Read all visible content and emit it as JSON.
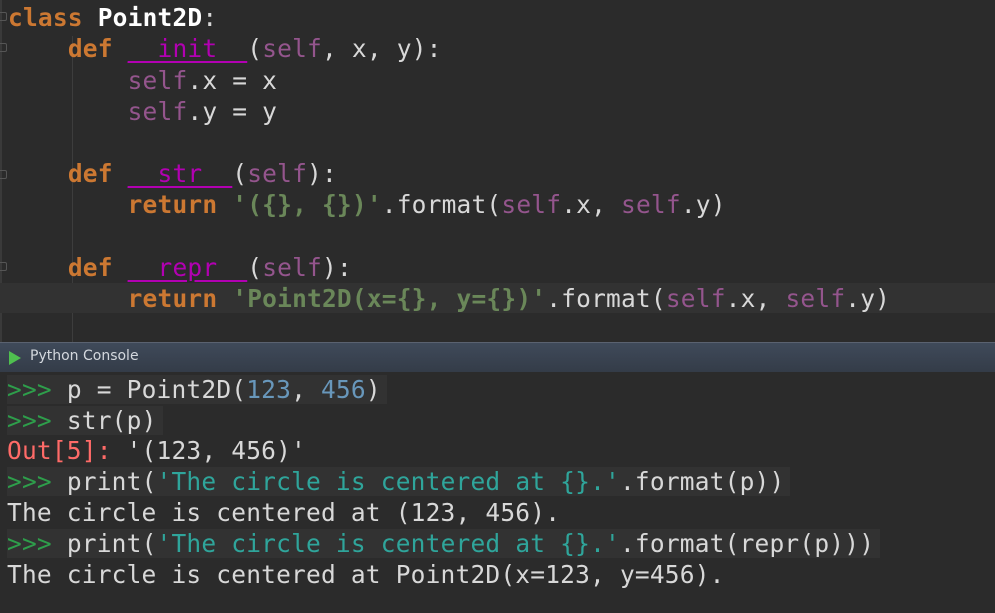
{
  "editor": {
    "lines": [
      {
        "segments": [
          [
            "kw",
            "class"
          ],
          [
            "plain",
            " "
          ],
          [
            "cls",
            "Point2D"
          ],
          [
            "plain",
            ":"
          ]
        ]
      },
      {
        "segments": [
          [
            "plain",
            "    "
          ],
          [
            "kw",
            "def"
          ],
          [
            "plain",
            " "
          ],
          [
            "dunder",
            "__init__"
          ],
          [
            "plain",
            "("
          ],
          [
            "self",
            "self"
          ],
          [
            "plain",
            ", x, y):"
          ]
        ]
      },
      {
        "segments": [
          [
            "plain",
            "        "
          ],
          [
            "self",
            "self"
          ],
          [
            "plain",
            ".x = x"
          ]
        ]
      },
      {
        "segments": [
          [
            "plain",
            "        "
          ],
          [
            "self",
            "self"
          ],
          [
            "plain",
            ".y = y"
          ]
        ]
      },
      {
        "segments": []
      },
      {
        "segments": [
          [
            "plain",
            "    "
          ],
          [
            "kw",
            "def"
          ],
          [
            "plain",
            " "
          ],
          [
            "dunder",
            "__str__"
          ],
          [
            "plain",
            "("
          ],
          [
            "self",
            "self"
          ],
          [
            "plain",
            "):"
          ]
        ]
      },
      {
        "segments": [
          [
            "plain",
            "        "
          ],
          [
            "kw",
            "return"
          ],
          [
            "plain",
            " "
          ],
          [
            "str",
            "'({}, {})'"
          ],
          [
            "plain",
            ".format("
          ],
          [
            "self",
            "self"
          ],
          [
            "plain",
            ".x, "
          ],
          [
            "self",
            "self"
          ],
          [
            "plain",
            ".y)"
          ]
        ]
      },
      {
        "segments": []
      },
      {
        "segments": [
          [
            "plain",
            "    "
          ],
          [
            "kw",
            "def"
          ],
          [
            "plain",
            " "
          ],
          [
            "dunder",
            "__repr__"
          ],
          [
            "plain",
            "("
          ],
          [
            "self",
            "self"
          ],
          [
            "plain",
            "):"
          ]
        ]
      },
      {
        "segments": [
          [
            "plain",
            "        "
          ],
          [
            "kw",
            "return"
          ],
          [
            "plain",
            " "
          ],
          [
            "str",
            "'Point2D(x={}, y={})'"
          ],
          [
            "plain",
            ".format("
          ],
          [
            "self",
            "self"
          ],
          [
            "plain",
            ".x, "
          ],
          [
            "self",
            "self"
          ],
          [
            "plain",
            ".y)"
          ]
        ]
      }
    ]
  },
  "console": {
    "title": "Python Console",
    "lines": [
      {
        "hl": true,
        "segments": [
          [
            "prompt",
            ">>> "
          ],
          [
            "plain",
            "p = Point2D("
          ],
          [
            "num",
            "123"
          ],
          [
            "plain",
            ", "
          ],
          [
            "num",
            "456"
          ],
          [
            "plain",
            ")"
          ]
        ]
      },
      {
        "hl": true,
        "segments": [
          [
            "prompt",
            ">>> "
          ],
          [
            "plain",
            "str(p)"
          ]
        ]
      },
      {
        "hl": false,
        "segments": [
          [
            "out",
            "Out[5]: "
          ],
          [
            "plain",
            "'(123, 456)'"
          ]
        ]
      },
      {
        "hl": true,
        "segments": [
          [
            "prompt",
            ">>> "
          ],
          [
            "plain",
            "print("
          ],
          [
            "cstr",
            "'The circle is centered at {}.'"
          ],
          [
            "plain",
            ".format(p))"
          ]
        ]
      },
      {
        "hl": false,
        "segments": [
          [
            "plain",
            "The circle is centered at (123, 456)."
          ]
        ]
      },
      {
        "hl": true,
        "segments": [
          [
            "prompt",
            ">>> "
          ],
          [
            "plain",
            "print("
          ],
          [
            "cstr",
            "'The circle is centered at {}.'"
          ],
          [
            "plain",
            ".format(repr(p)))"
          ]
        ]
      },
      {
        "hl": false,
        "segments": [
          [
            "plain",
            "The circle is centered at Point2D(x=123, y=456)."
          ]
        ]
      }
    ]
  }
}
